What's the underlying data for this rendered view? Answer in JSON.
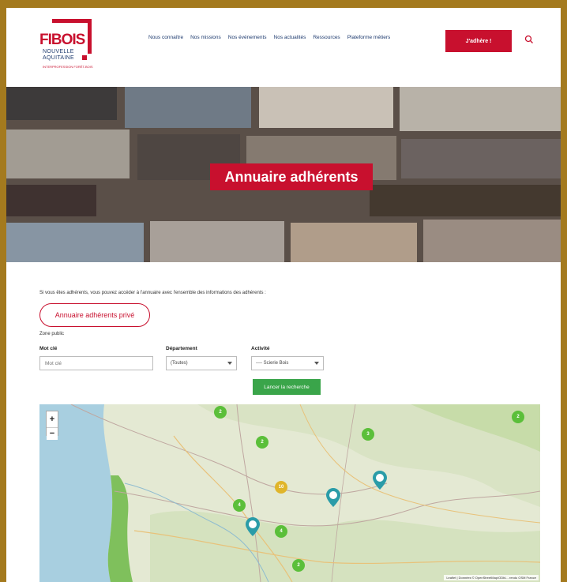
{
  "brand": {
    "name": "FIBOIS",
    "line1": "NOUVELLE",
    "line2": "AQUITAINE",
    "tagline": "INTERPROFESSION FORÊT-BOIS",
    "color": "#c8102e"
  },
  "nav": {
    "items": [
      "Nous connaître",
      "Nos missions",
      "Nos événements",
      "Nos actualités",
      "Ressources",
      "Plateforme métiers"
    ],
    "join_label": "J'adhère !"
  },
  "banner": {
    "title": "Annuaire adhérents"
  },
  "content": {
    "intro": "Si vous êtes adhérents, vous pouvez accéder à l'annuaire avec l'ensemble des informations des adhérents :",
    "private_button": "Annuaire adhérents privé",
    "zone_label": "Zone public"
  },
  "search": {
    "keyword_label": "Mot clé",
    "keyword_placeholder": "Mot clé",
    "department_label": "Département",
    "department_value": "(Toutes)",
    "activity_label": "Activité",
    "activity_value": "---- Scierie Bois",
    "launch_button": "Lancer la recherche"
  },
  "map": {
    "zoom_in": "+",
    "zoom_out": "−",
    "attribution": "Leaflet | Données © OpenStreetMap/ODbL - rendu OSM France",
    "clusters": [
      {
        "count": "2",
        "color": "#5bbf3a"
      },
      {
        "count": "2",
        "color": "#5bbf3a"
      },
      {
        "count": "3",
        "color": "#5bbf3a"
      },
      {
        "count": "2",
        "color": "#5bbf3a"
      },
      {
        "count": "10",
        "color": "#e0b52a"
      },
      {
        "count": "4",
        "color": "#5bbf3a"
      },
      {
        "count": "4",
        "color": "#5bbf3a"
      },
      {
        "count": "2",
        "color": "#5bbf3a"
      }
    ],
    "marker_color": "#2a9ca8"
  }
}
